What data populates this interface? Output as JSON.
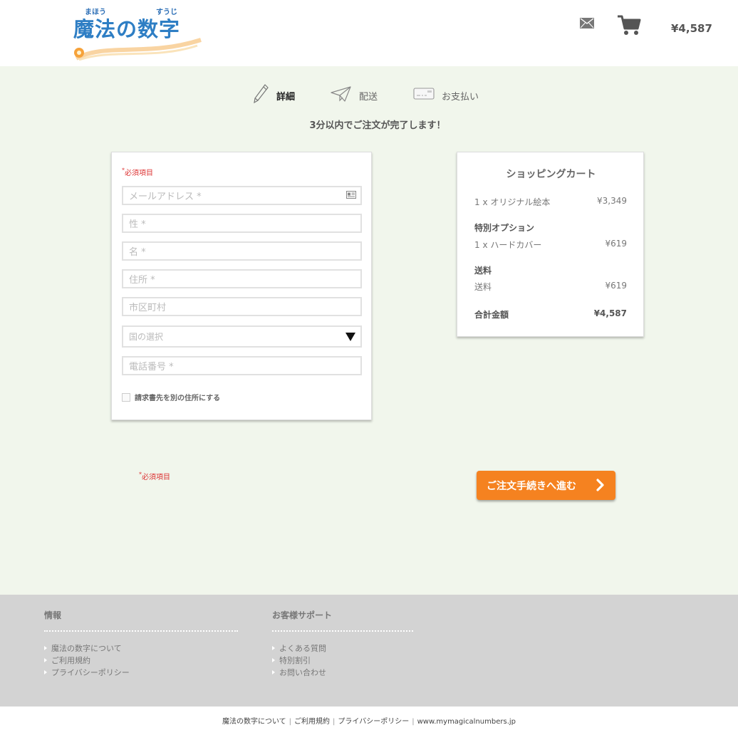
{
  "header": {
    "logo_ruby_left": "まほう",
    "logo_ruby_right": "すうじ",
    "logo_title": "魔法の数字",
    "cart_total": "¥4,587"
  },
  "steps": [
    {
      "label": "詳細",
      "icon": "pencil-icon",
      "active": true
    },
    {
      "label": "配送",
      "icon": "paper-plane-icon",
      "active": false
    },
    {
      "label": "お支払い",
      "icon": "credit-card-icon",
      "active": false
    }
  ],
  "intro": "3分以内でご注文が完了します！",
  "form": {
    "required_note": "必須項目",
    "email_placeholder": "メールアドレス *",
    "last_name_placeholder": "性 *",
    "first_name_placeholder": "名 *",
    "address_placeholder": "住所 *",
    "city_placeholder": "市区町村",
    "country_select": "国の選択",
    "phone_placeholder": "電話番号 *",
    "billing_checkbox_label": "請求書先を別の住所にする"
  },
  "cart": {
    "title": "ショッピングカート",
    "item_label": "1 x オリジナル絵本",
    "item_price": "¥3,349",
    "options_heading": "特別オプション",
    "option_label": "1 x ハードカバー",
    "option_price": "¥619",
    "shipping_heading": "送料",
    "shipping_label": "送料",
    "shipping_price": "¥619",
    "total_label": "合計金額",
    "total_price": "¥4,587"
  },
  "required_note_bottom": "必須項目",
  "proceed_button": "ご注文手続きへ進む",
  "footer": {
    "col1_heading": "情報",
    "col1_links": [
      "魔法の数字について",
      "ご利用規約",
      "プライバシーポリシー"
    ],
    "col2_heading": "お客様サポート",
    "col2_links": [
      "よくある質問",
      "特別割引",
      "お問い合わせ"
    ]
  },
  "bottom_bar": {
    "link1": "魔法の数字について",
    "link2": "ご利用規約",
    "link3": "プライバシーポリシー",
    "domain": "www.mymagicalnumbers.jp",
    "separator": "|"
  },
  "colors": {
    "accent": "#f58220",
    "page_bg": "#f1f6ec",
    "logo_blue": "#2e7ec4",
    "required_red": "#d33333"
  }
}
